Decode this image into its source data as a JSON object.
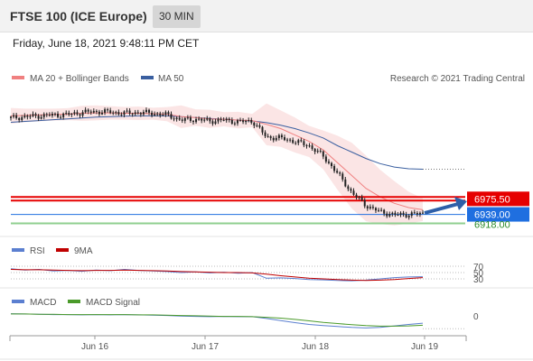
{
  "header": {
    "title": "FTSE 100 (ICE Europe)",
    "timeframe": "30 MIN"
  },
  "datetime": "Friday, June 18, 2021 9:48:11 PM CET",
  "legend": {
    "ma20": "MA 20 + Bollinger Bands",
    "ma50": "MA 50",
    "credit": "Research © 2021 Trading Central",
    "rsi": "RSI",
    "rsi_ma": "9MA",
    "macd": "MACD",
    "macd_signal": "MACD Signal"
  },
  "colors": {
    "ma20": "#f08080",
    "ma50": "#3a5fa0",
    "bands": "#f9d3d3",
    "resistance": "#e60000",
    "current": "#1f6fe0",
    "support": "#2a8a2a",
    "rsi": "#5b7fd0",
    "rsi_ma": "#c00000",
    "macd": "#5b7fd0",
    "macd_signal": "#4a9a2a",
    "candle": "#222222"
  },
  "chart_data": [
    {
      "type": "candlestick",
      "x_ticks": [
        "Jun 16",
        "Jun 17",
        "Jun 18",
        "Jun 19"
      ],
      "levels": [
        {
          "label": "6975.50",
          "value": 6975.5,
          "role": "resistance"
        },
        {
          "label": "6939.00",
          "value": 6939.0,
          "role": "current"
        },
        {
          "label": "6918.00",
          "value": 6918.0,
          "role": "support"
        }
      ],
      "price_path": [
        7165,
        7168,
        7170,
        7172,
        7173,
        7178,
        7180,
        7179,
        7176,
        7178,
        7176,
        7172,
        7160,
        7162,
        7158,
        7160,
        7156,
        7158,
        7120,
        7118,
        7110,
        7100,
        7075,
        7035,
        6990,
        6960,
        6945,
        6938,
        6939,
        6941
      ],
      "ma20_path": [
        7170,
        7171,
        7172,
        7173,
        7174,
        7176,
        7177,
        7177,
        7176,
        7176,
        7175,
        7174,
        7168,
        7166,
        7163,
        7162,
        7160,
        7159,
        7150,
        7140,
        7125,
        7110,
        7090,
        7060,
        7030,
        7000,
        6980,
        6965,
        6955,
        6950
      ],
      "ma50_path": [
        7155,
        7157,
        7159,
        7161,
        7163,
        7165,
        7167,
        7168,
        7169,
        7170,
        7170,
        7170,
        7168,
        7166,
        7164,
        7162,
        7160,
        7158,
        7154,
        7148,
        7140,
        7130,
        7118,
        7100,
        7085,
        7070,
        7058,
        7050,
        7046,
        7045
      ],
      "ma50_last": 7045,
      "ylim": [
        6900,
        7230
      ]
    },
    {
      "type": "line",
      "title": "RSI",
      "y_ticks": [
        70,
        50,
        30
      ],
      "ylim": [
        10,
        90
      ],
      "series": [
        {
          "name": "RSI",
          "values": [
            62,
            58,
            60,
            55,
            57,
            54,
            58,
            56,
            60,
            57,
            55,
            53,
            50,
            52,
            49,
            51,
            48,
            50,
            32,
            33,
            31,
            28,
            27,
            25,
            24,
            26,
            30,
            34,
            36,
            37
          ]
        },
        {
          "name": "9MA",
          "values": [
            60,
            59,
            59,
            58,
            57,
            56,
            57,
            57,
            58,
            57,
            56,
            55,
            53,
            52,
            51,
            50,
            50,
            49,
            45,
            40,
            36,
            32,
            30,
            28,
            26,
            25,
            26,
            28,
            31,
            34
          ]
        }
      ]
    },
    {
      "type": "line",
      "title": "MACD",
      "y_ticks": [
        0
      ],
      "ylim": [
        -60,
        25
      ],
      "series": [
        {
          "name": "MACD",
          "values": [
            8,
            7,
            6,
            5,
            5,
            4,
            5,
            4,
            5,
            4,
            3,
            2,
            0,
            -1,
            -2,
            -1,
            -2,
            -2,
            -8,
            -15,
            -22,
            -28,
            -32,
            -35,
            -38,
            -40,
            -38,
            -33,
            -28,
            -24
          ]
        },
        {
          "name": "MACD Signal",
          "values": [
            7,
            7,
            6,
            6,
            5,
            5,
            5,
            5,
            5,
            4,
            4,
            3,
            2,
            1,
            0,
            -1,
            -1,
            -2,
            -4,
            -7,
            -11,
            -16,
            -21,
            -25,
            -29,
            -32,
            -34,
            -34,
            -33,
            -31
          ]
        }
      ]
    }
  ]
}
